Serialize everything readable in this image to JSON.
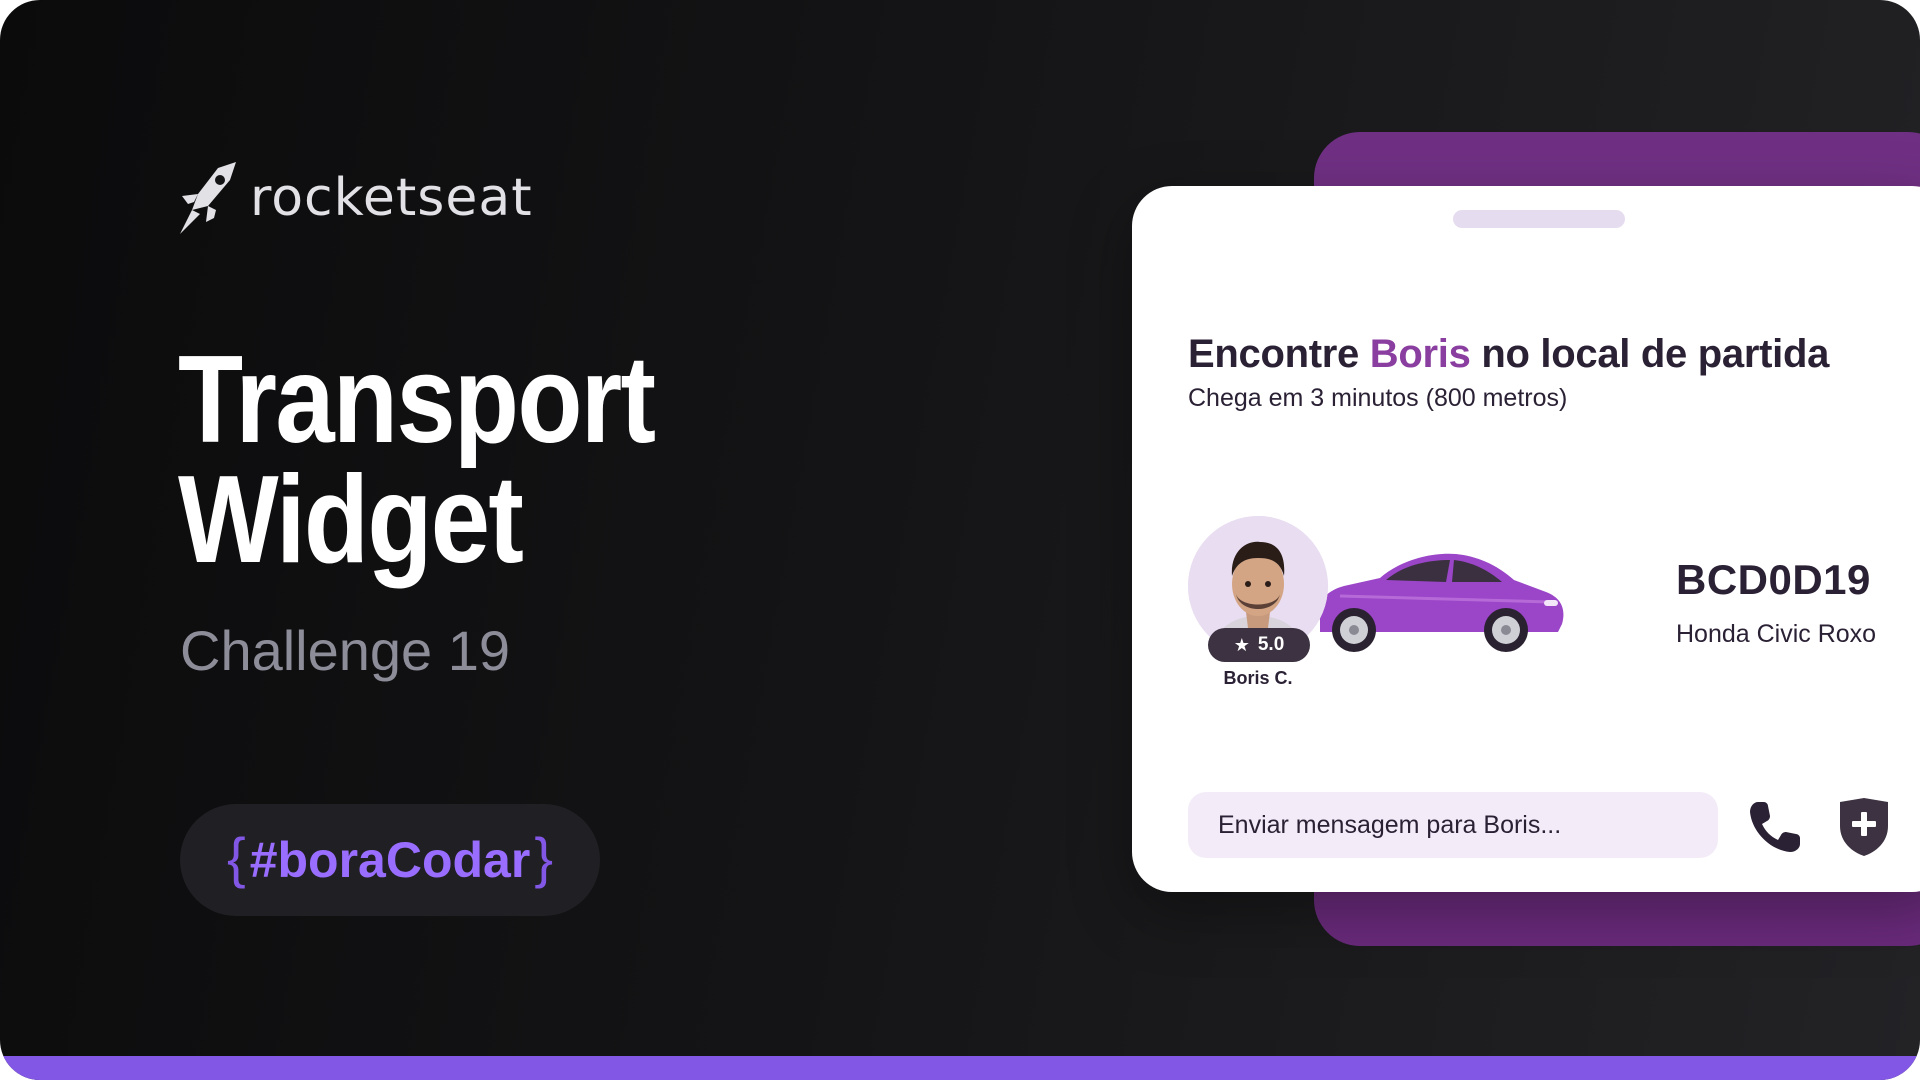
{
  "brand": {
    "name": "rocketseat",
    "logo_icon": "rocket-icon"
  },
  "hero": {
    "title_line1": "Transport",
    "title_line2": "Widget",
    "challenge": "Challenge 19",
    "hashtag": "#boraCodar",
    "brace_open": "{",
    "brace_close": "}"
  },
  "widget": {
    "heading_prefix": "Encontre ",
    "heading_driver": "Boris",
    "heading_suffix": " no local de partida",
    "eta": "Chega em 3 minutos (800 metros)",
    "driver": {
      "name": "Boris C.",
      "rating": "5.0",
      "avatar_icon": "driver-avatar"
    },
    "car": {
      "plate": "BCD0D19",
      "model": "Honda Civic Roxo",
      "icon": "car-icon"
    },
    "message_placeholder": "Enviar mensagem para Boris...",
    "call_icon": "phone-icon",
    "safety_icon": "shield-plus-icon"
  },
  "colors": {
    "brand_purple": "#8257e5",
    "accent_purple": "#8a3ea0",
    "widget_back": "#7d3a8e",
    "text_dark": "#2b2135"
  }
}
